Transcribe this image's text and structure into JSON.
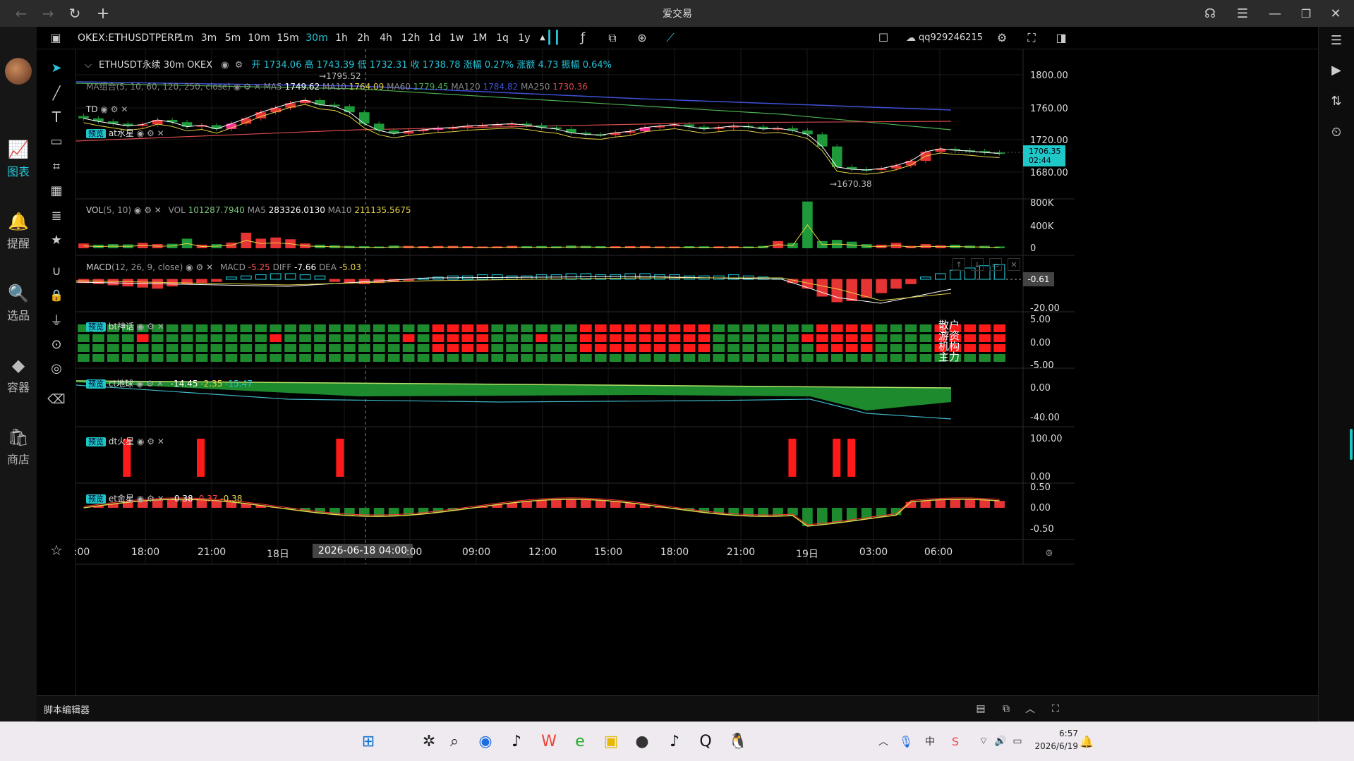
{
  "window": {
    "title": "爱交易"
  },
  "nav": [
    {
      "label": "图表",
      "icon": "chart-icon",
      "active": true
    },
    {
      "label": "提醒",
      "icon": "bell-icon"
    },
    {
      "label": "选品",
      "icon": "search-chart-icon"
    },
    {
      "label": "容器",
      "icon": "container-icon"
    },
    {
      "label": "商店",
      "icon": "store-icon"
    }
  ],
  "toolbar": {
    "symbol": "OKEX:ETHUSDTPERP",
    "intervals": [
      "1m",
      "3m",
      "5m",
      "10m",
      "15m",
      "30m",
      "1h",
      "2h",
      "4h",
      "12h",
      "1d",
      "1w",
      "1M",
      "1q",
      "1y"
    ],
    "active_interval": "30m",
    "user": "qq929246215"
  },
  "main_header": {
    "title": "ETHUSDT永续 30m OKEX",
    "open_label": "开",
    "open": "1734.06",
    "high_label": "高",
    "high": "1743.39",
    "low_label": "低",
    "low": "1732.31",
    "close_label": "收",
    "close": "1738.78",
    "chg_pct_label": "涨幅",
    "chg_pct": "0.27%",
    "chg_label": "涨额",
    "chg": "4.73",
    "amp_label": "振幅",
    "amp": "0.64%"
  },
  "ma_legend": {
    "name": "MA组合",
    "params": "(5, 10, 60, 120, 250, close)",
    "items": [
      {
        "label": "MA5",
        "value": "1749.62",
        "color": "#ffffff"
      },
      {
        "label": "MA10",
        "value": "1764.09",
        "color": "#e6d34a"
      },
      {
        "label": "MA60",
        "value": "1779.45",
        "color": "#4caf50"
      },
      {
        "label": "MA120",
        "value": "1784.82",
        "color": "#3f51d8"
      },
      {
        "label": "MA250",
        "value": "1730.36",
        "color": "#d84a4a"
      }
    ]
  },
  "td_label": "TD",
  "at_label": "at水星",
  "preview_badge": "预览",
  "main_y_labels": [
    "1800.00",
    "1760.00",
    "1720.00",
    "1680.00"
  ],
  "price_tag": {
    "price": "1706.35",
    "countdown": "02:44"
  },
  "hi_mark": "1795.52",
  "lo_mark": "1670.38",
  "vol": {
    "name": "VOL",
    "params": "(5, 10)",
    "vol_label": "VOL",
    "vol": "101287.7940",
    "ma5_label": "MA5",
    "ma5": "283326.0130",
    "ma10_label": "MA10",
    "ma10": "211135.5675",
    "y_labels": [
      "800K",
      "400K",
      "0"
    ]
  },
  "macd": {
    "name": "MACD",
    "params": "(12, 26, 9, close)",
    "macd_label": "MACD",
    "macd": "-5.25",
    "diff_label": "DIFF",
    "diff": "-7.66",
    "dea_label": "DEA",
    "dea": "-5.03",
    "y_labels": [
      "-0.61",
      "-20.00"
    ]
  },
  "bt": {
    "name": "bt神话",
    "y_labels": [
      "5.00",
      "0.00",
      "-5.00"
    ],
    "row_labels": [
      "散户",
      "游资",
      "机构",
      "主力"
    ]
  },
  "ct": {
    "name": "ct地球",
    "v1": "-14.45",
    "v2": "-2.35",
    "v3": "-15.47",
    "y_labels": [
      "0.00",
      "-40.00"
    ]
  },
  "dt": {
    "name": "dt火星",
    "y_labels": [
      "100.00",
      "0.00"
    ]
  },
  "et": {
    "name": "et金星",
    "v1": "-0.38",
    "v2": "-0.37",
    "v3": "-0.38",
    "y_labels": [
      "0.50",
      "0.00",
      "-0.50"
    ]
  },
  "x_labels": [
    ":00",
    "18:00",
    "21:00",
    "18日",
    "2026-06-18  04:00",
    ":00",
    "09:00",
    "12:00",
    "15:00",
    "18:00",
    "21:00",
    "19日",
    "03:00",
    "06:00"
  ],
  "script_editor": "脚本编辑器",
  "clock": {
    "time": "6:57",
    "date": "2026/6/19"
  },
  "chart_data": {
    "type": "candlestick",
    "interval": "30m",
    "y_range": [
      1665,
      1815
    ],
    "candles_close_approx": [
      1752,
      1748,
      1745,
      1742,
      1744,
      1750,
      1747,
      1741,
      1743,
      1738,
      1745,
      1752,
      1760,
      1766,
      1772,
      1776,
      1770,
      1768,
      1760,
      1745,
      1736,
      1732,
      1735,
      1737,
      1739,
      1740,
      1742,
      1743,
      1744,
      1745,
      1743,
      1740,
      1738,
      1733,
      1731,
      1730,
      1733,
      1735,
      1740,
      1742,
      1744,
      1741,
      1738,
      1740,
      1742,
      1741,
      1738,
      1739,
      1736,
      1731,
      1715,
      1688,
      1685,
      1684,
      1686,
      1690,
      1696,
      1708,
      1712,
      1710,
      1709,
      1707,
      1706
    ],
    "volume_approx": [
      80,
      60,
      70,
      65,
      90,
      70,
      75,
      160,
      60,
      70,
      95,
      260,
      160,
      180,
      150,
      80,
      60,
      50,
      40,
      35,
      30,
      45,
      40,
      35,
      38,
      40,
      35,
      30,
      32,
      40,
      35,
      38,
      33,
      45,
      40,
      35,
      34,
      36,
      38,
      32,
      30,
      35,
      33,
      32,
      34,
      31,
      40,
      120,
      90,
      780,
      120,
      140,
      110,
      70,
      60,
      90,
      40,
      70,
      50,
      60,
      45,
      40,
      30
    ],
    "macd_hist_approx": [
      -3,
      -4,
      -5,
      -6,
      -7,
      -8,
      -6,
      -4,
      -3,
      -2,
      2,
      3,
      4,
      5,
      5,
      4,
      3,
      -2,
      -3,
      -4,
      -3,
      -2,
      -1,
      1,
      2,
      3,
      3,
      4,
      4,
      3,
      3,
      4,
      4,
      5,
      5,
      4,
      4,
      5,
      5,
      4,
      4,
      3,
      3,
      3,
      4,
      3,
      2,
      1,
      -3,
      -8,
      -15,
      -20,
      -19,
      -16,
      -12,
      -8,
      -4,
      2,
      5,
      8,
      10,
      12,
      13
    ],
    "dt_bars_index": [
      2,
      7,
      17,
      48,
      51,
      52
    ]
  }
}
